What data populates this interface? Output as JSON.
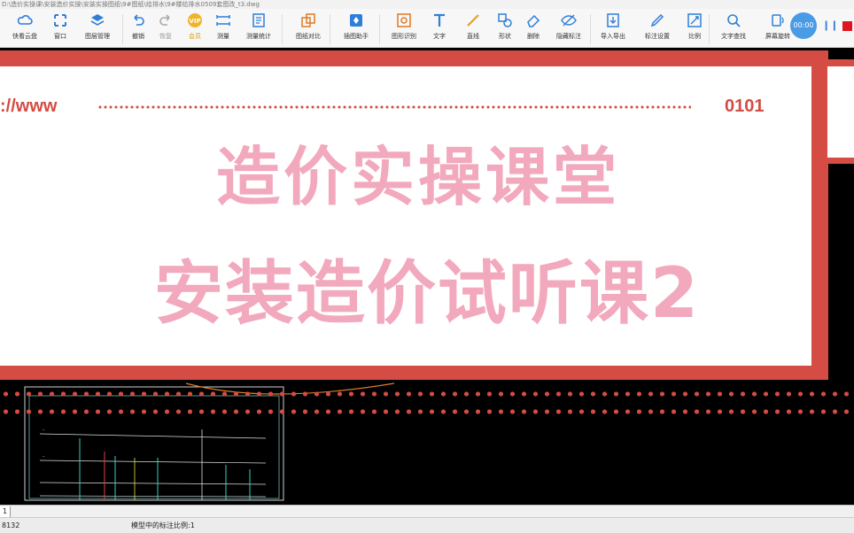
{
  "window": {
    "title": "D:\\造价实操课\\安装造价实操\\安装实操图纸\\9#图纸\\给排水\\9#楼给排水0509套图改_t3.dwg"
  },
  "toolbar": {
    "items": [
      {
        "label": "快看云盘",
        "icon": "cloud-icon"
      },
      {
        "label": "窗口",
        "icon": "window-icon"
      },
      {
        "label": "图层管理",
        "icon": "layers-icon"
      },
      {
        "label": "撤销",
        "icon": "undo-icon"
      },
      {
        "label": "恢复",
        "icon": "redo-icon"
      },
      {
        "label": "会员",
        "icon": "vip-icon"
      },
      {
        "label": "测量",
        "icon": "measure-icon"
      },
      {
        "label": "测量统计",
        "icon": "measure-stats-icon"
      },
      {
        "label": "图纸对比",
        "icon": "compare-icon"
      },
      {
        "label": "插图助手",
        "icon": "assistant-icon"
      },
      {
        "label": "图形识别",
        "icon": "recognize-icon"
      },
      {
        "label": "文字",
        "icon": "text-icon"
      },
      {
        "label": "直线",
        "icon": "line-icon"
      },
      {
        "label": "形状",
        "icon": "shape-icon"
      },
      {
        "label": "删除",
        "icon": "eraser-icon"
      },
      {
        "label": "隐藏标注",
        "icon": "hide-icon"
      },
      {
        "label": "导入导出",
        "icon": "import-export-icon"
      },
      {
        "label": "标注设置",
        "icon": "annotation-settings-icon"
      },
      {
        "label": "比例",
        "icon": "scale-icon"
      },
      {
        "label": "文字查找",
        "icon": "text-search-icon"
      },
      {
        "label": "屏幕旋转",
        "icon": "rotate-screen-icon"
      }
    ]
  },
  "recorder": {
    "timer": "00:00"
  },
  "banner": {
    "url_text": "://www",
    "code_text": "0101",
    "headline_1": "造价实操课堂",
    "headline_2": "安装造价试听课2"
  },
  "layout_tabs": [
    "1"
  ],
  "status": {
    "coordinates": "8132",
    "scale_note": "模型中的标注比例:1"
  },
  "colors": {
    "banner_red": "#d44c43",
    "headline_pink": "#f2a8bd",
    "cad_background": "#000000",
    "recorder_blue": "#4a9be6",
    "recorder_stop": "#e0141e"
  }
}
